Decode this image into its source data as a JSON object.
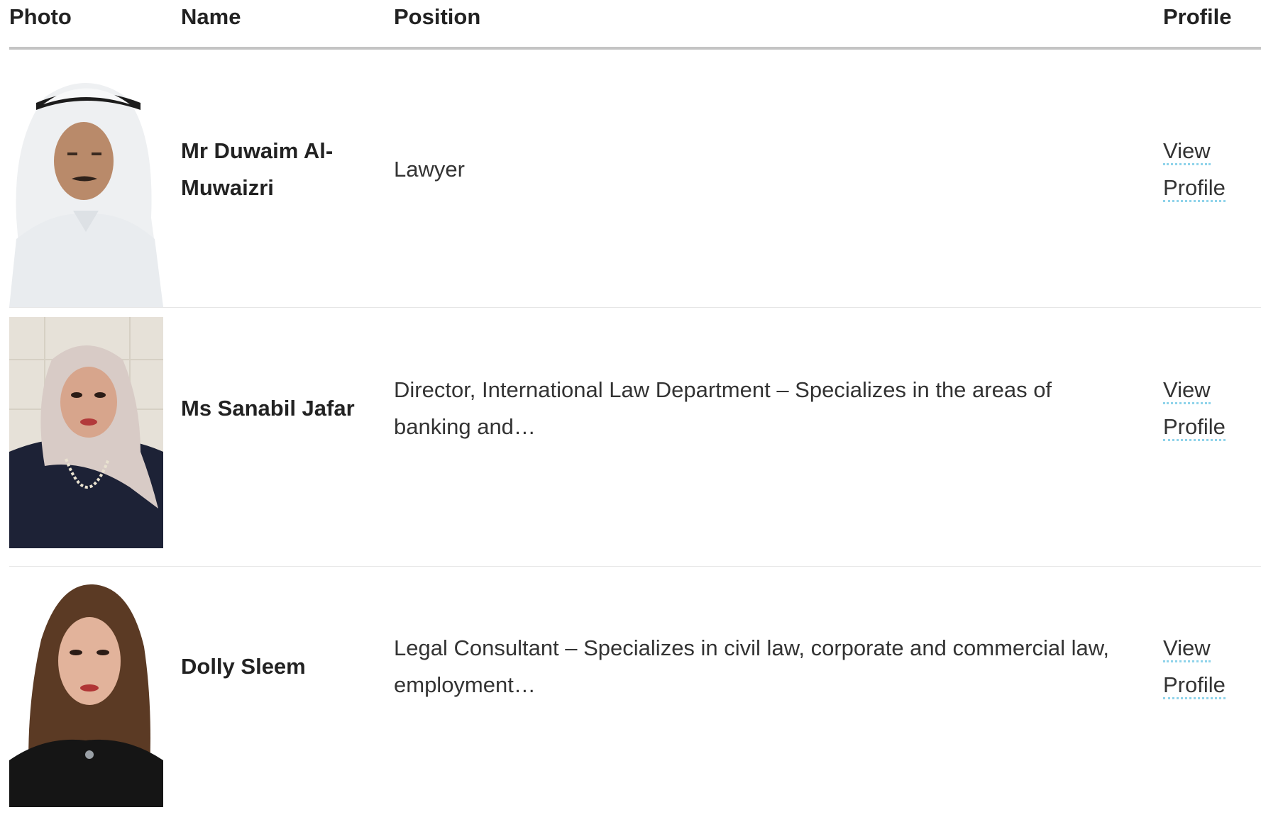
{
  "table": {
    "headers": {
      "photo": "Photo",
      "name": "Name",
      "position": "Position",
      "profile": "Profile"
    },
    "rows": [
      {
        "name": "Mr Duwaim Al-Muwaizri",
        "position": "Lawyer",
        "link_line1": "View",
        "link_line2": "Profile"
      },
      {
        "name": "Ms Sanabil Jafar",
        "position": "Director, International Law Department – Specializes in the areas of banking and…",
        "link_line1": "View",
        "link_line2": "Profile"
      },
      {
        "name": "Dolly Sleem",
        "position": "Legal Consultant – Specializes in civil law, corporate and commercial law, employment…",
        "link_line1": "View",
        "link_line2": "Profile"
      }
    ]
  },
  "colors": {
    "link_underline": "#8fd3ea",
    "header_rule": "#c4c4c4",
    "row_rule": "#e6e6e6"
  }
}
